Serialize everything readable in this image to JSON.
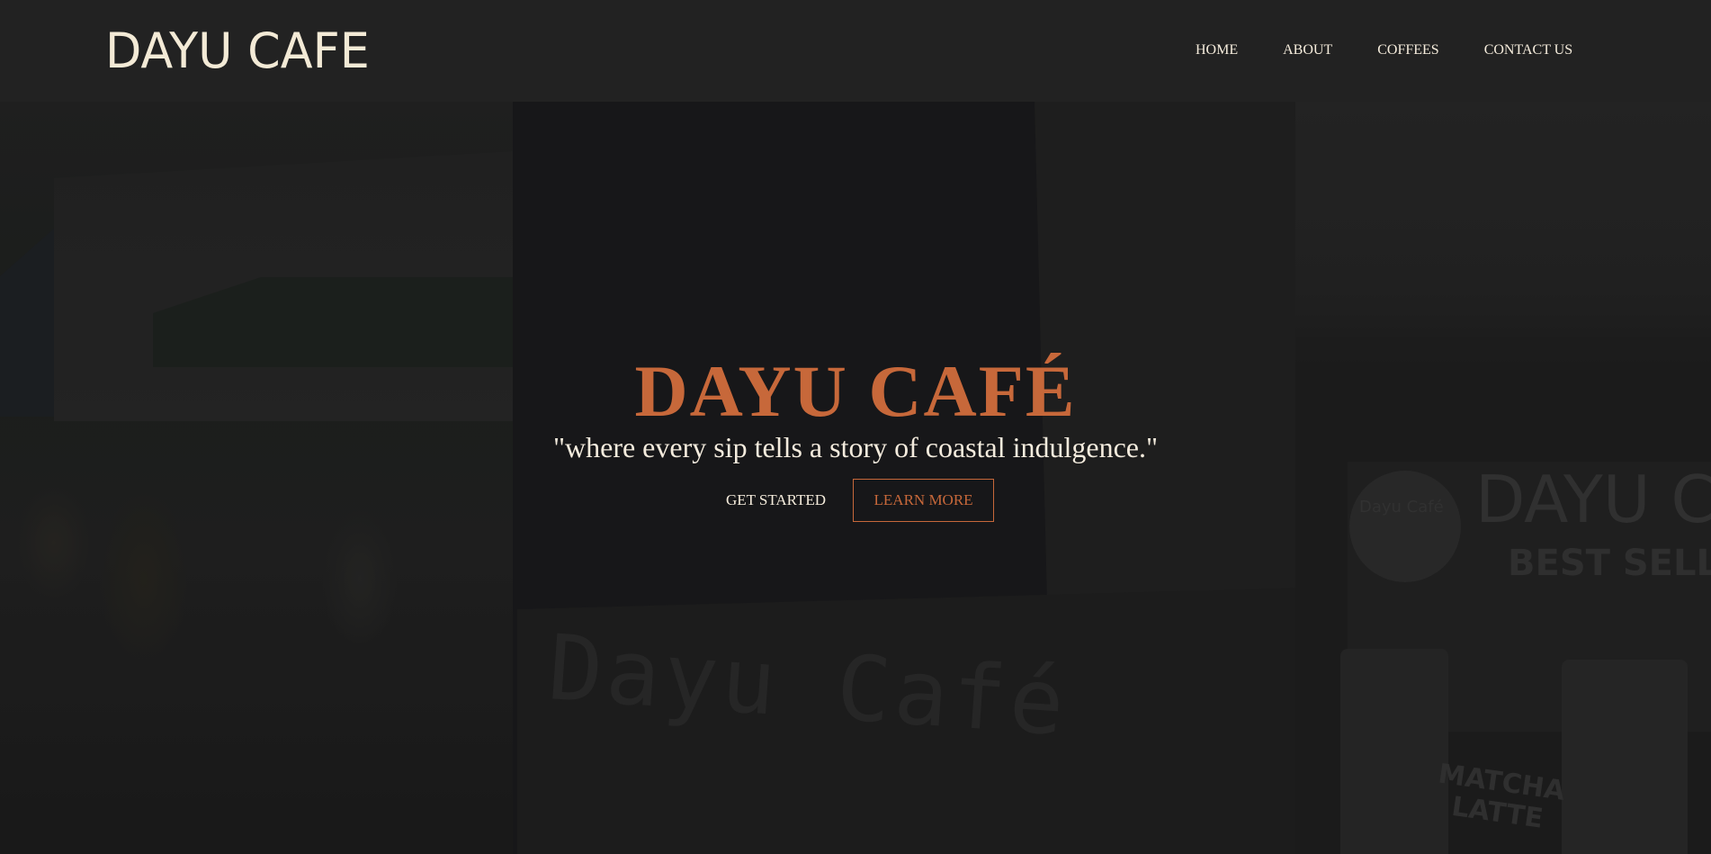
{
  "header": {
    "logo": "DAYU CAFE",
    "nav": [
      {
        "label": "HOME"
      },
      {
        "label": "ABOUT"
      },
      {
        "label": "COFFEES"
      },
      {
        "label": "CONTACT US"
      }
    ]
  },
  "hero": {
    "title": "DAYU CAFÉ",
    "tagline": "\"where every sip tells a story of coastal indulgence.\"",
    "buttons": {
      "get_started": "GET STARTED",
      "learn_more": "LEARN MORE"
    },
    "background_signage": {
      "stall_text": "Dayu Café",
      "banner_brand": "DAYU CA",
      "banner_sub": "BEST SELLE",
      "circle_logo": "Dayu Café",
      "bag_label_line1": "MATCHA",
      "bag_label_line2": "LATTE"
    }
  },
  "colors": {
    "header_bg": "#222222",
    "accent": "#c7683a",
    "text_light": "#f3ebdd"
  }
}
